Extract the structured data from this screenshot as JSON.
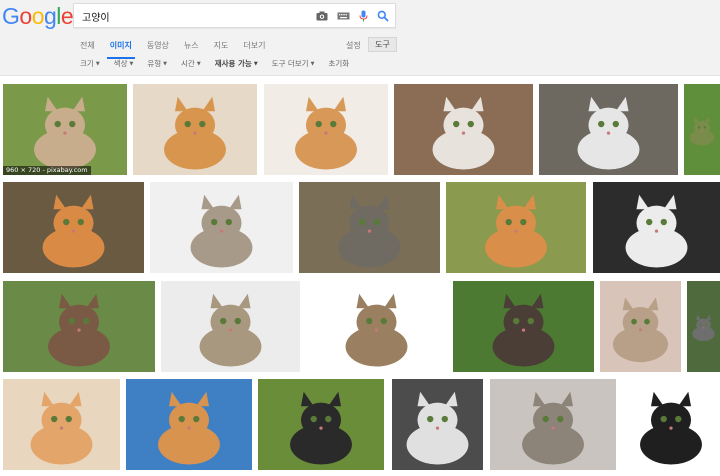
{
  "logo": {
    "letters": [
      "G",
      "o",
      "o",
      "g",
      "l",
      "e"
    ],
    "colors": [
      "#4285f4",
      "#ea4335",
      "#fbbc05",
      "#4285f4",
      "#34a853",
      "#ea4335"
    ]
  },
  "search": {
    "value": "고양이",
    "icons": [
      "camera-icon",
      "keyboard-icon",
      "microphone-icon",
      "search-icon"
    ]
  },
  "tabs": [
    "전체",
    "이미지",
    "동영상",
    "뉴스",
    "지도",
    "더보기"
  ],
  "active_tab": "이미지",
  "settings_label": "설정",
  "tools_label": "도구",
  "filters": [
    {
      "label": "크기",
      "dropdown": true
    },
    {
      "label": "색상",
      "dropdown": true
    },
    {
      "label": "유형",
      "dropdown": true
    },
    {
      "label": "시간",
      "dropdown": true
    },
    {
      "label": "재사용 가능",
      "dropdown": true,
      "bold": true
    },
    {
      "label": "도구 더보기",
      "dropdown": true
    },
    {
      "label": "초기화",
      "dropdown": false
    }
  ],
  "first_image_caption": "960 × 720 - pixabay.com",
  "accent_color": "#1a73e8",
  "image_results": [
    {
      "bg": "#7a9a4a",
      "cat": "#c8ad8c"
    },
    {
      "bg": "#e6d9c8",
      "cat": "#d8954e"
    },
    {
      "bg": "#f1ece6",
      "cat": "#d89858"
    },
    {
      "bg": "#8b6d55",
      "cat": "#e8e2dc"
    },
    {
      "bg": "#6d6860",
      "cat": "#e6e6e6"
    },
    {
      "bg": "#5f8f3a",
      "cat": "#7a8c4a"
    },
    {
      "bg": "#6a5a42",
      "cat": "#d98a45"
    },
    {
      "bg": "#f0f0f0",
      "cat": "#a89a88"
    },
    {
      "bg": "#7a6e56",
      "cat": "#6f6a62"
    },
    {
      "bg": "#8a9a4f",
      "cat": "#d98f4a"
    },
    {
      "bg": "#2c2c2c",
      "cat": "#ececec"
    },
    {
      "bg": "#6a8a48",
      "cat": "#7a5a44"
    },
    {
      "bg": "#ececec",
      "cat": "#a89880"
    },
    {
      "bg": "#ffffff",
      "cat": "#9a8060"
    },
    {
      "bg": "#4d7a33",
      "cat": "#4a3e36"
    },
    {
      "bg": "#d8c4b8",
      "cat": "#b8a088"
    },
    {
      "bg": "#4f6a3c",
      "cat": "#6e6e6e"
    },
    {
      "bg": "#e9d6be",
      "cat": "#e3a56a"
    },
    {
      "bg": "#3f7fc4",
      "cat": "#d8944e"
    },
    {
      "bg": "#6a8d3a",
      "cat": "#2a2a2a"
    },
    {
      "bg": "#4c4c4c",
      "cat": "#e0e0e0"
    },
    {
      "bg": "#c9c4bf",
      "cat": "#8c8478"
    },
    {
      "bg": "#ffffff",
      "cat": "#1f1f1f"
    }
  ]
}
